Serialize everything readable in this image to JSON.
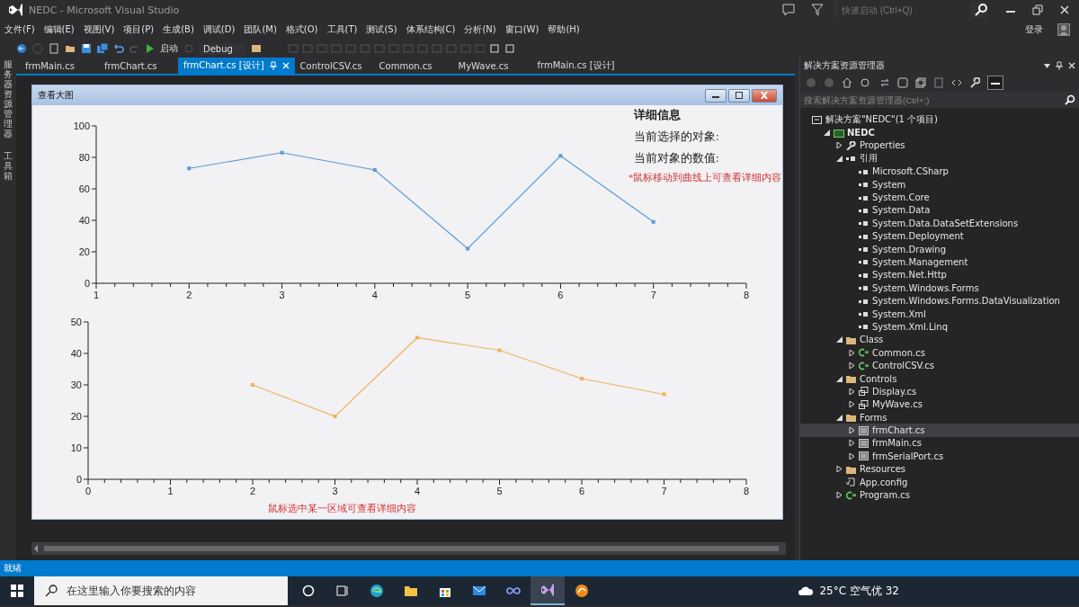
{
  "window": {
    "title": "NEDC - Microsoft Visual Studio"
  },
  "quick_launch": {
    "placeholder": "快速启动 (Ctrl+Q)"
  },
  "sign_in": "登录",
  "menu": [
    "文件(F)",
    "编辑(E)",
    "视图(V)",
    "项目(P)",
    "生成(B)",
    "调试(D)",
    "团队(M)",
    "格式(O)",
    "工具(T)",
    "测试(S)",
    "体系结构(C)",
    "分析(N)",
    "窗口(W)",
    "帮助(H)"
  ],
  "toolbar": {
    "start": "启动",
    "configuration": "Debug"
  },
  "side_tabs": [
    "服务器资源管理器",
    "工具箱"
  ],
  "tabs": [
    {
      "label": "frmMain.cs",
      "selected": false
    },
    {
      "label": "frmChart.cs",
      "selected": false
    },
    {
      "label": "frmChart.cs [设计]",
      "selected": true
    },
    {
      "label": "ControlCSV.cs",
      "selected": false
    },
    {
      "label": "Common.cs",
      "selected": false
    },
    {
      "label": "MyWave.cs",
      "selected": false
    },
    {
      "label": "frmMain.cs [设计]",
      "selected": false
    }
  ],
  "form": {
    "title": "查看大图",
    "info_title": "详细信息",
    "selected_object_label": "当前选择的对象:",
    "value_label": "当前对象的数值:",
    "hint_top": "*鼠标移动到曲线上可查看详细内容",
    "hint_bottom": "鼠标选中某一区域可查看详细内容",
    "charts": [
      {
        "chart_data": {
          "type": "line",
          "x": [
            2,
            3,
            4,
            5,
            6,
            7
          ],
          "series": [
            {
              "color": "#5b9bd5",
              "marker": "square",
              "values": [
                73,
                83,
                72,
                22,
                81,
                39
              ]
            }
          ],
          "xlim": [
            1,
            8
          ],
          "ylim": [
            0,
            100
          ],
          "xticks": [
            1,
            2,
            3,
            4,
            5,
            6,
            7,
            8
          ],
          "yticks": [
            0,
            20,
            40,
            60,
            80,
            100
          ]
        }
      },
      {
        "chart_data": {
          "type": "line",
          "x": [
            2,
            3,
            4,
            5,
            6,
            7
          ],
          "series": [
            {
              "color": "#f2b25c",
              "marker": "square",
              "values": [
                30,
                20,
                45,
                41,
                32,
                27
              ]
            }
          ],
          "xlim": [
            0,
            8
          ],
          "ylim": [
            0,
            50
          ],
          "xticks": [
            0,
            1,
            2,
            3,
            4,
            5,
            6,
            7,
            8
          ],
          "yticks": [
            0,
            10,
            20,
            30,
            40,
            50
          ]
        }
      }
    ]
  },
  "solution_explorer": {
    "title": "解决方案资源管理器",
    "search": {
      "placeholder": "搜索解决方案资源管理器(Ctrl+;)"
    },
    "tree": [
      {
        "label": "解决方案\"NEDC\"(1 个项目)",
        "kind": "solution",
        "selected": false,
        "children": [
          {
            "label": "NEDC",
            "kind": "project",
            "expanded": true,
            "selected": false,
            "children": [
              {
                "label": "Properties",
                "kind": "properties",
                "expanded": false,
                "selected": false
              },
              {
                "label": "引用",
                "kind": "references",
                "expanded": true,
                "selected": false,
                "children": [
                  {
                    "label": "Microsoft.CSharp",
                    "kind": "reference",
                    "selected": false
                  },
                  {
                    "label": "System",
                    "kind": "reference",
                    "selected": false
                  },
                  {
                    "label": "System.Core",
                    "kind": "reference",
                    "selected": false
                  },
                  {
                    "label": "System.Data",
                    "kind": "reference",
                    "selected": false
                  },
                  {
                    "label": "System.Data.DataSetExtensions",
                    "kind": "reference",
                    "selected": false
                  },
                  {
                    "label": "System.Deployment",
                    "kind": "reference",
                    "selected": false
                  },
                  {
                    "label": "System.Drawing",
                    "kind": "reference",
                    "selected": false
                  },
                  {
                    "label": "System.Management",
                    "kind": "reference",
                    "selected": false
                  },
                  {
                    "label": "System.Net.Http",
                    "kind": "reference",
                    "selected": false
                  },
                  {
                    "label": "System.Windows.Forms",
                    "kind": "reference",
                    "selected": false
                  },
                  {
                    "label": "System.Windows.Forms.DataVisualization",
                    "kind": "reference",
                    "selected": false
                  },
                  {
                    "label": "System.Xml",
                    "kind": "reference",
                    "selected": false
                  },
                  {
                    "label": "System.Xml.Linq",
                    "kind": "reference",
                    "selected": false
                  }
                ]
              },
              {
                "label": "Class",
                "kind": "folder",
                "expanded": true,
                "selected": false,
                "children": [
                  {
                    "label": "Common.cs",
                    "kind": "csharp",
                    "expanded": false,
                    "selected": false
                  },
                  {
                    "label": "ControlCSV.cs",
                    "kind": "csharp",
                    "expanded": false,
                    "selected": false
                  }
                ]
              },
              {
                "label": "Controls",
                "kind": "folder",
                "expanded": true,
                "selected": false,
                "children": [
                  {
                    "label": "Display.cs",
                    "kind": "control",
                    "expanded": false,
                    "selected": false
                  },
                  {
                    "label": "MyWave.cs",
                    "kind": "control",
                    "expanded": false,
                    "selected": false
                  }
                ]
              },
              {
                "label": "Forms",
                "kind": "folder",
                "expanded": true,
                "selected": false,
                "children": [
                  {
                    "label": "frmChart.cs",
                    "kind": "form",
                    "expanded": false,
                    "selected": true
                  },
                  {
                    "label": "frmMain.cs",
                    "kind": "form",
                    "expanded": false,
                    "selected": false
                  },
                  {
                    "label": "frmSerialPort.cs",
                    "kind": "form",
                    "expanded": false,
                    "selected": false
                  }
                ]
              },
              {
                "label": "Resources",
                "kind": "folder",
                "expanded": false,
                "selected": false
              },
              {
                "label": "App.config",
                "kind": "config",
                "selected": false
              },
              {
                "label": "Program.cs",
                "kind": "csharp",
                "expanded": false,
                "selected": false
              }
            ]
          }
        ]
      }
    ]
  },
  "status_bar": {
    "text": "就绪"
  },
  "taskbar": {
    "search": {
      "placeholder": "在这里输入你要搜索的内容"
    },
    "weather": "25°C 空气优 32"
  }
}
